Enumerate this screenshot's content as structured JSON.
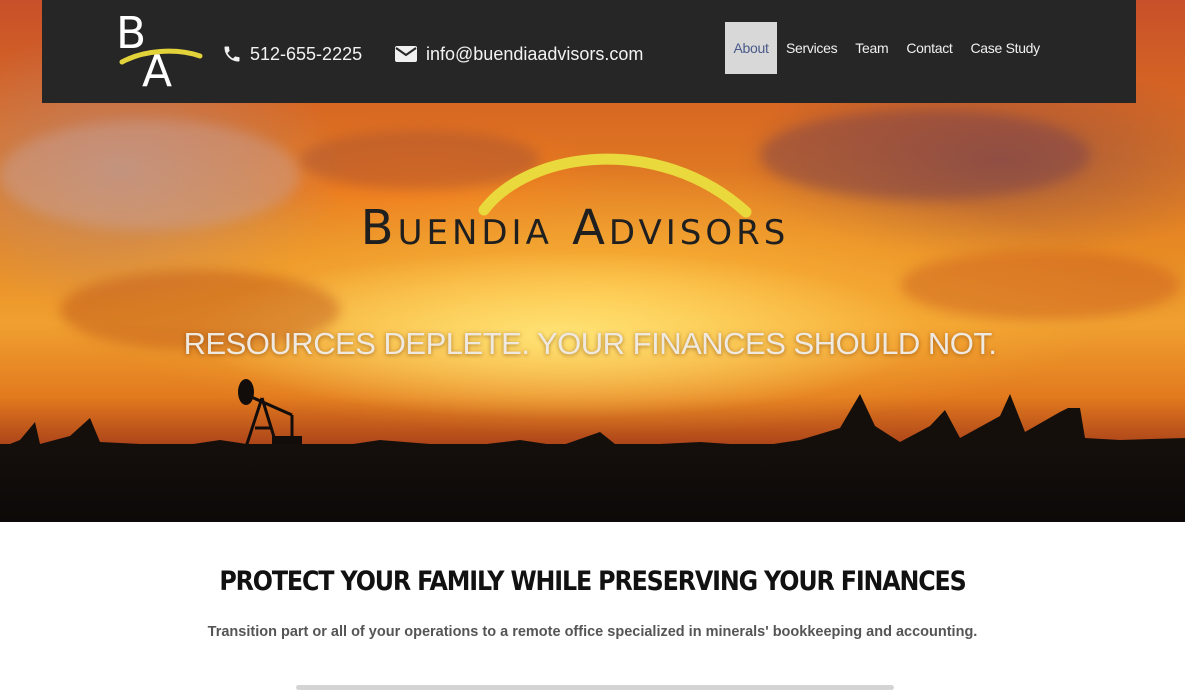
{
  "header": {
    "logo_letters": "BA",
    "phone": "512-655-2225",
    "email": "info@buendiaadvisors.com",
    "icons": {
      "phone": "phone-icon",
      "email": "envelope-icon"
    },
    "nav": [
      {
        "label": "About",
        "active": true
      },
      {
        "label": "Services",
        "active": false
      },
      {
        "label": "Team",
        "active": false
      },
      {
        "label": "Contact",
        "active": false
      },
      {
        "label": "Case Study",
        "active": false
      }
    ]
  },
  "hero": {
    "brand_name": "Buendia Advisors",
    "tagline": "RESOURCES DEPLETE. YOUR FINANCES SHOULD NOT."
  },
  "content": {
    "title": "PROTECT YOUR FAMILY WHILE PRESERVING YOUR FINANCES",
    "text": "Transition part or all of your operations to a remote office specialized in minerals' bookkeeping and accounting."
  },
  "colors": {
    "topbar": "#262626",
    "accent_yellow": "#e7d53a",
    "nav_active_bg": "#d8d8d8"
  }
}
